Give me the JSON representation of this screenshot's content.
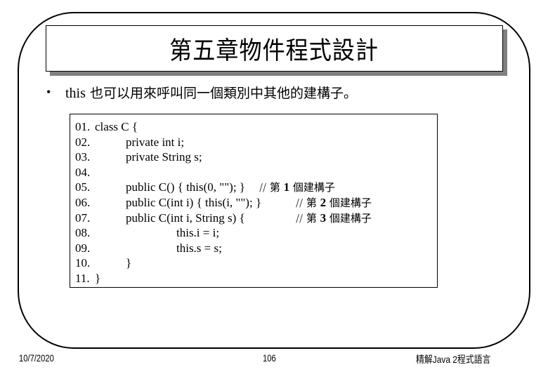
{
  "slide": {
    "title": "第五章物件程式設計",
    "bullets": [
      {
        "marker": "•",
        "latin": "this",
        "text": " 也可以用來呼叫同一個類別中其他的建構子。"
      }
    ],
    "code": {
      "lines": [
        {
          "num": "01.",
          "indent": 0,
          "code": "class C {",
          "comment": ""
        },
        {
          "num": "02.",
          "indent": 1,
          "code": "private int i;",
          "comment": ""
        },
        {
          "num": "03.",
          "indent": 1,
          "code": "private String s;",
          "comment": ""
        },
        {
          "num": "04.",
          "indent": 1,
          "code": "",
          "comment": ""
        },
        {
          "num": "05.",
          "indent": 1,
          "code": "public C() { this(0, \"\"); }",
          "comment_prefix": "// 第 ",
          "comment_num": "1",
          "comment_suffix": " 個建構子",
          "comment_col": 0
        },
        {
          "num": "06.",
          "indent": 1,
          "code": "public C(int i) { this(i, \"\"); }",
          "comment_prefix": "// 第 ",
          "comment_num": "2",
          "comment_suffix": " 個建構子",
          "comment_col": 1
        },
        {
          "num": "07.",
          "indent": 1,
          "code": "public C(int i, String s) {",
          "comment_prefix": "// 第 ",
          "comment_num": "3",
          "comment_suffix": " 個建構子",
          "comment_col": 1
        },
        {
          "num": "08.",
          "indent": 2,
          "code": "this.i = i;",
          "comment": ""
        },
        {
          "num": "09.",
          "indent": 2,
          "code": "this.s = s;",
          "comment": ""
        },
        {
          "num": "10.",
          "indent": 1,
          "code": "}",
          "comment": ""
        },
        {
          "num": "11.",
          "indent": 0,
          "code": "}",
          "comment": ""
        }
      ]
    }
  },
  "footer": {
    "date": "10/7/2020",
    "page": "106",
    "book": "精解Java 2程式語言"
  }
}
